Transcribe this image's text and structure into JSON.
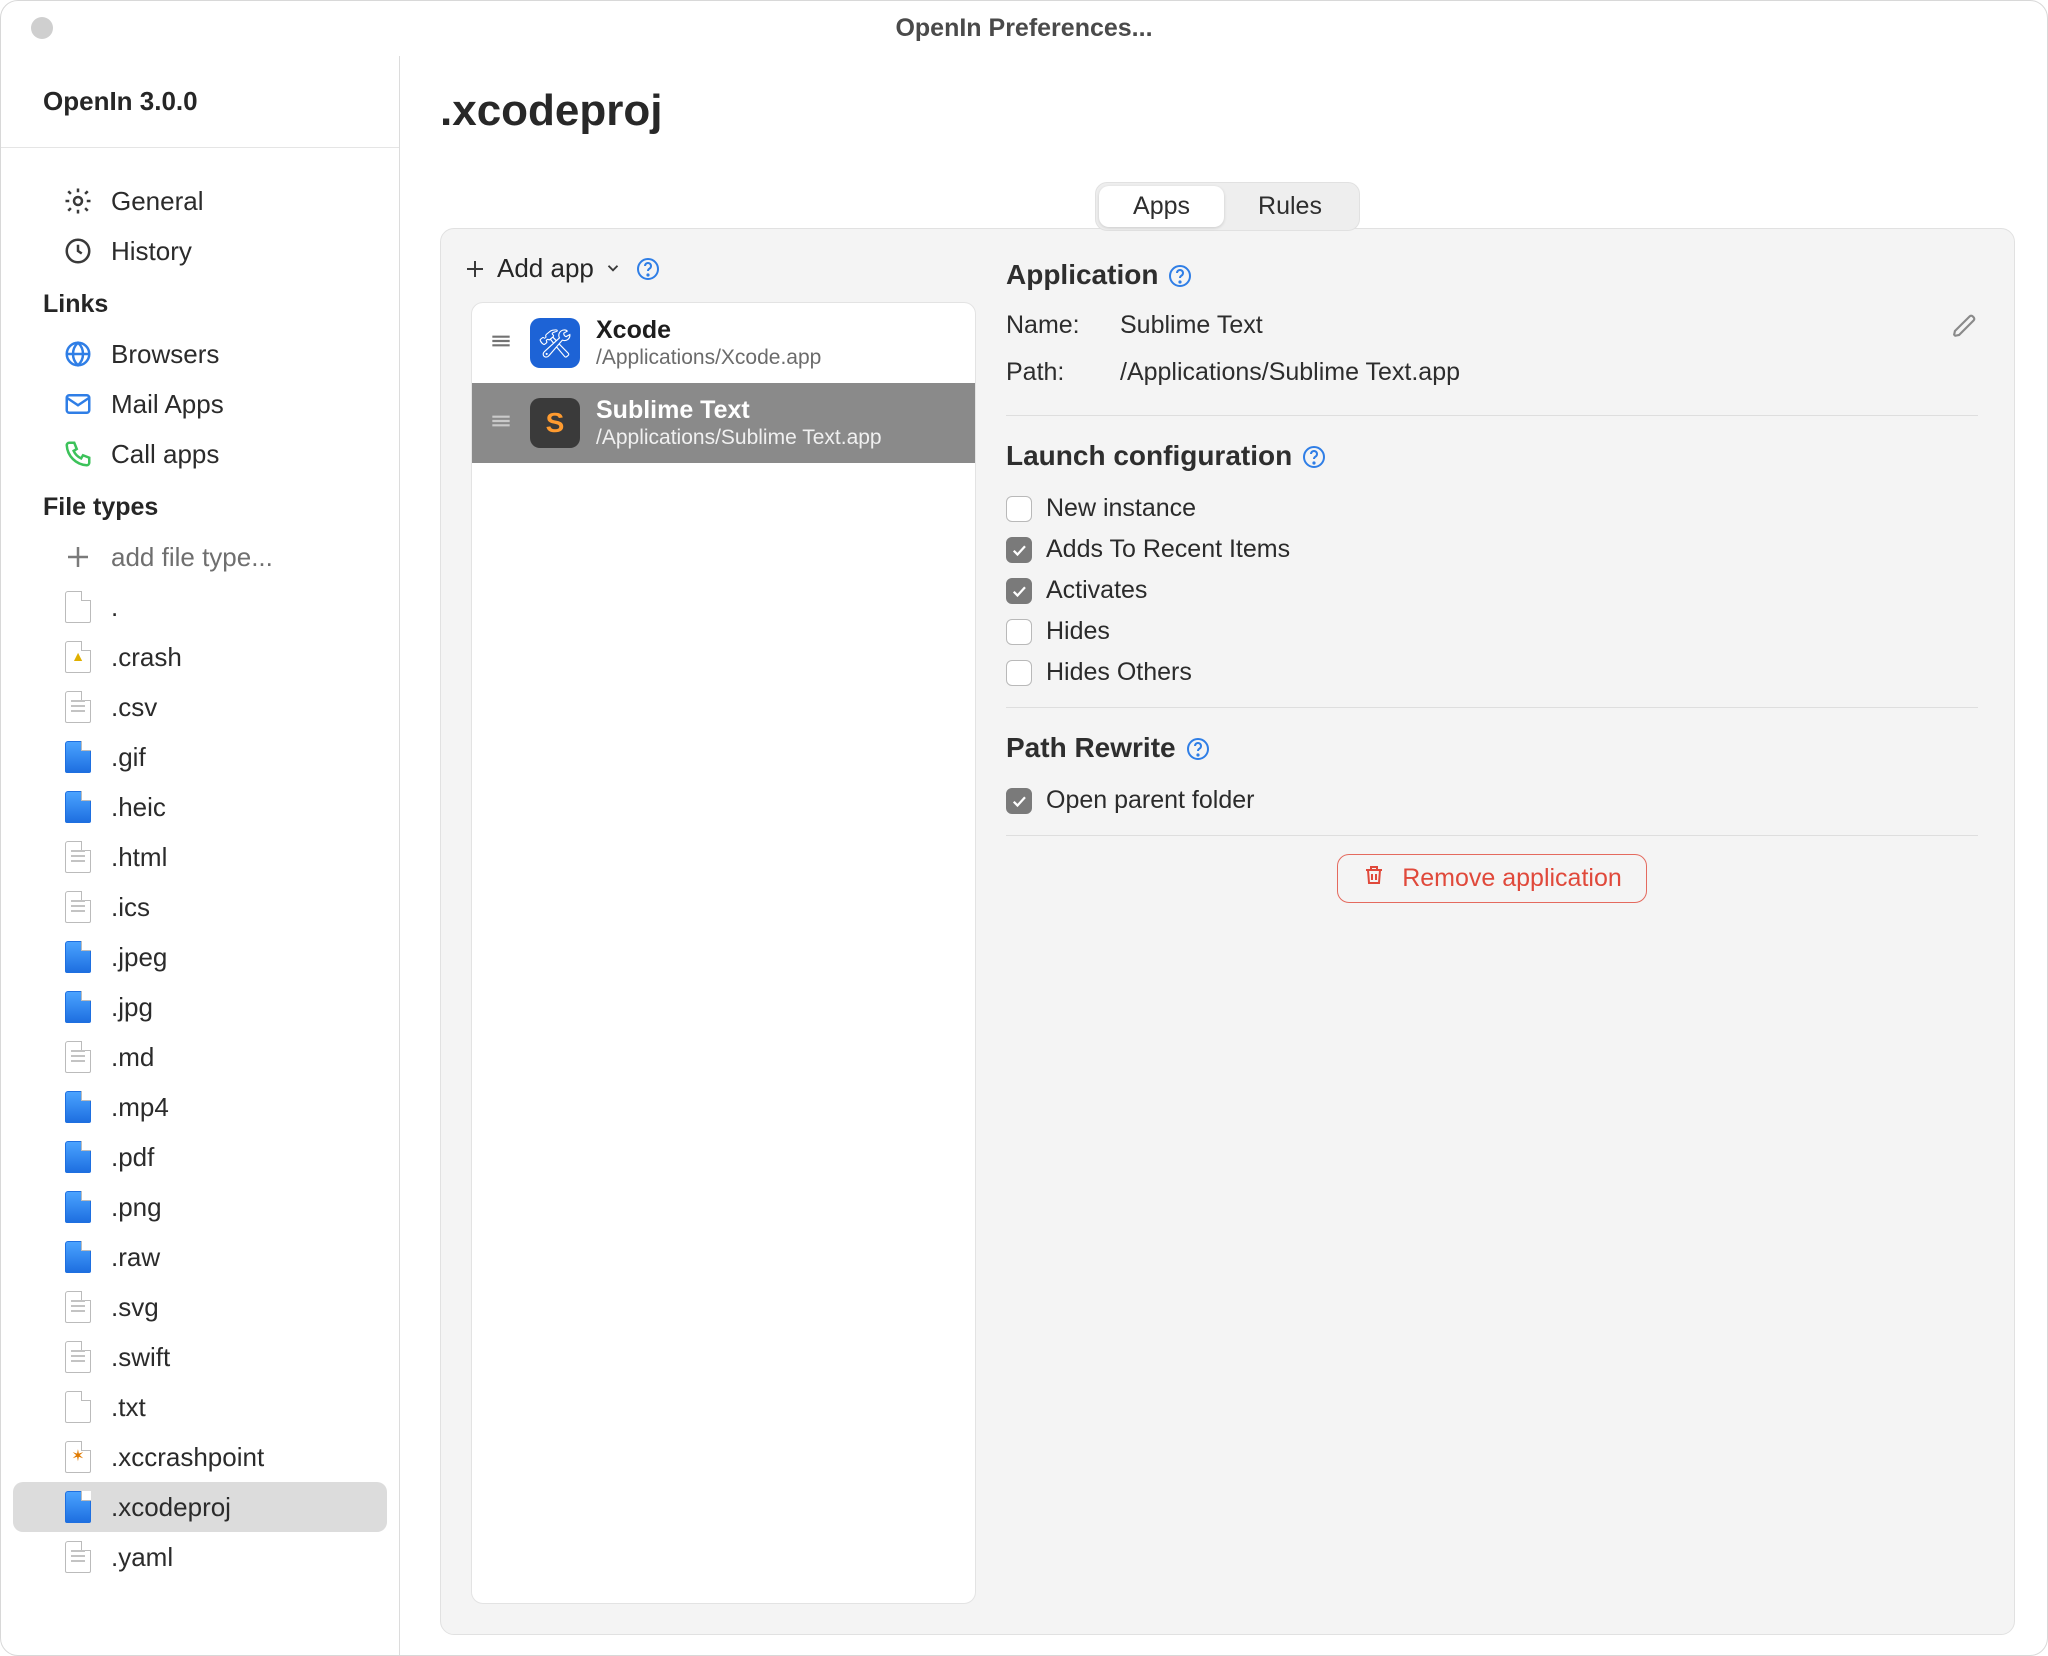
{
  "window": {
    "title": "OpenIn Preferences..."
  },
  "sidebar": {
    "app_title": "OpenIn 3.0.0",
    "top_items": [
      {
        "label": "General",
        "icon": "gear"
      },
      {
        "label": "History",
        "icon": "clock"
      }
    ],
    "links_header": "Links",
    "links": [
      {
        "label": "Browsers",
        "icon": "globe"
      },
      {
        "label": "Mail Apps",
        "icon": "mail"
      },
      {
        "label": "Call apps",
        "icon": "phone"
      }
    ],
    "filetypes_header": "File types",
    "add_filetype_label": "add file type...",
    "filetypes": [
      {
        "label": ".",
        "ico": "plain"
      },
      {
        "label": ".crash",
        "ico": "yellow"
      },
      {
        "label": ".csv",
        "ico": "lines"
      },
      {
        "label": ".gif",
        "ico": "blue"
      },
      {
        "label": ".heic",
        "ico": "blue"
      },
      {
        "label": ".html",
        "ico": "lines"
      },
      {
        "label": ".ics",
        "ico": "lines"
      },
      {
        "label": ".jpeg",
        "ico": "blue"
      },
      {
        "label": ".jpg",
        "ico": "blue"
      },
      {
        "label": ".md",
        "ico": "lines"
      },
      {
        "label": ".mp4",
        "ico": "blue"
      },
      {
        "label": ".pdf",
        "ico": "blue"
      },
      {
        "label": ".png",
        "ico": "blue"
      },
      {
        "label": ".raw",
        "ico": "blue"
      },
      {
        "label": ".svg",
        "ico": "lines"
      },
      {
        "label": ".swift",
        "ico": "lines"
      },
      {
        "label": ".txt",
        "ico": "plain"
      },
      {
        "label": ".xccrashpoint",
        "ico": "spark"
      },
      {
        "label": ".xcodeproj",
        "ico": "blue",
        "selected": true
      },
      {
        "label": ".yaml",
        "ico": "lines"
      }
    ]
  },
  "main": {
    "title": ".xcodeproj",
    "tabs": {
      "apps": "Apps",
      "rules": "Rules",
      "active": "apps"
    },
    "add_app_label": "Add app",
    "apps": [
      {
        "name": "Xcode",
        "path": "/Applications/Xcode.app",
        "icon": "xcode"
      },
      {
        "name": "Sublime Text",
        "path": "/Applications/Sublime Text.app",
        "icon": "sublime",
        "selected": true
      }
    ],
    "application": {
      "header": "Application",
      "name_key": "Name:",
      "path_key": "Path:",
      "name_val": "Sublime Text",
      "path_val": "/Applications/Sublime Text.app"
    },
    "launch": {
      "header": "Launch configuration",
      "items": [
        {
          "label": "New instance",
          "checked": false
        },
        {
          "label": "Adds To Recent Items",
          "checked": true
        },
        {
          "label": "Activates",
          "checked": true
        },
        {
          "label": "Hides",
          "checked": false
        },
        {
          "label": "Hides Others",
          "checked": false
        }
      ]
    },
    "rewrite": {
      "header": "Path Rewrite",
      "items": [
        {
          "label": "Open parent folder",
          "checked": true
        }
      ]
    },
    "remove_label": "Remove application"
  }
}
